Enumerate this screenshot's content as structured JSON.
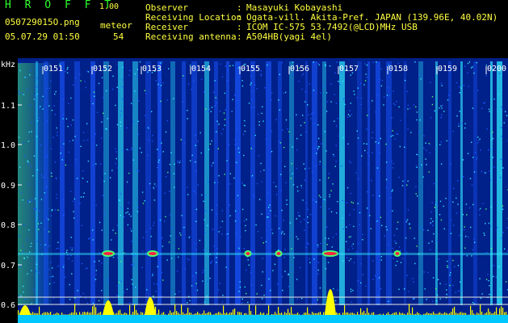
{
  "header": {
    "app_title": "H R O F F T",
    "version": "1.00",
    "filename": "050729015O.png",
    "datetime": "05.07.29 01:50",
    "meteor_label": "meteor",
    "meteor_count": "54",
    "info": [
      {
        "label": "Observer",
        "value": "Masayuki Kobayashi"
      },
      {
        "label": "Receiving Location",
        "value": "Ogata-vill. Akita-Pref. JAPAN (139.96E, 40.02N)"
      },
      {
        "label": "Receiver",
        "value": "ICOM IC-575 53.7492(@LCD)MHz USB"
      },
      {
        "label": "Receiving antenna",
        "value": "A504HB(yagi 4el)"
      }
    ]
  },
  "spectrogram": {
    "unit": "kHz",
    "time_labels": [
      "0151",
      "0152",
      "0153",
      "0154",
      "0155",
      "0156",
      "0157",
      "0158",
      "0159",
      "0200"
    ],
    "freq_labels": [
      "1.1",
      "1.0",
      "0.9",
      "0.8",
      "0.7",
      "0.6"
    ],
    "colors": {
      "background": "#00208a",
      "noise_low": "#1a56ff",
      "noise_high": "#2ee8ff",
      "green": "#4cff70",
      "histogram": "#ffff00",
      "baseline": "#00c8ff"
    }
  }
}
